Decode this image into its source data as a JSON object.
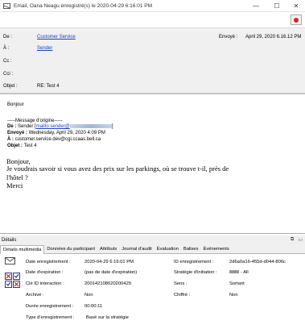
{
  "window": {
    "title": "Email, Oana Neagu enregistré(s) le 2020-04-29 6:16:01 PM",
    "minimize_glyph": "—",
    "maximize_glyph": "☐",
    "close_glyph": "✕"
  },
  "header": {
    "from_label": "De :",
    "from_value": "Customer Service",
    "to_label": "À :",
    "to_value": "Sender",
    "cc_label": "Cc :",
    "bcc_label": "Cci :",
    "subject_label": "Objet :",
    "subject_value": "RE: Test 4",
    "sent_label": "Envoyé :",
    "sent_value": "April 29, 2020 6.16.12 PM"
  },
  "body": {
    "greeting": "Bonjour",
    "original_marker": "-----Message d'origine-----",
    "orig_from_label": "De :",
    "orig_from_value": "Sender [",
    "orig_from_mailto": "mailto:sender@",
    "orig_from_end": "]",
    "orig_sent_label": "Envoyé :",
    "orig_sent_value": "Wednesday, April 29, 2020 4:09 PM",
    "orig_to_label": "À :",
    "orig_to_value": "customer.service.dev@cgi.ccaas.bell.ca",
    "orig_subject_label": "Objet :",
    "orig_subject_value": "Test 4",
    "msg_greeting": "Bonjour,",
    "msg_line1": "Je voudrais savoir si vous avez des prix sur les parkings, où se trouve t-il, près de",
    "msg_line2": "l'hôtel ?",
    "msg_closing": "Merci"
  },
  "details": {
    "title": "Détails",
    "tabs": [
      "Détails multimédia",
      "Données du participant",
      "Attributs",
      "Journal d'audit",
      "Évaluation",
      "Balises",
      "Événements"
    ],
    "date_label": "Date enregistrement :",
    "date_value": "2020-04-29 6:16:01 PM",
    "expiry_label": "Date d'expiration :",
    "expiry_value": "(pas de date d'expiration)",
    "interaction_label": "Clé ID interaction :",
    "interaction_value": "200142108020200429",
    "archive_label": "Archivé :",
    "archive_value": "Non",
    "duration_label": "Durée enregistrement :",
    "duration_value": "00:00:11",
    "type_label": "Type d'enregistrement :",
    "type_value": "Basé sur la stratégie",
    "rec_id_label": "ID enregistrement :",
    "rec_id_value": "2d6a0a16-455d-d044-806c",
    "strategy_label": "Stratégie d'initiation :",
    "strategy_value": "- All",
    "direction_label": "Sens :",
    "direction_value": "Sortant",
    "encrypted_label": "Chiffré :",
    "encrypted_value": "Non"
  }
}
